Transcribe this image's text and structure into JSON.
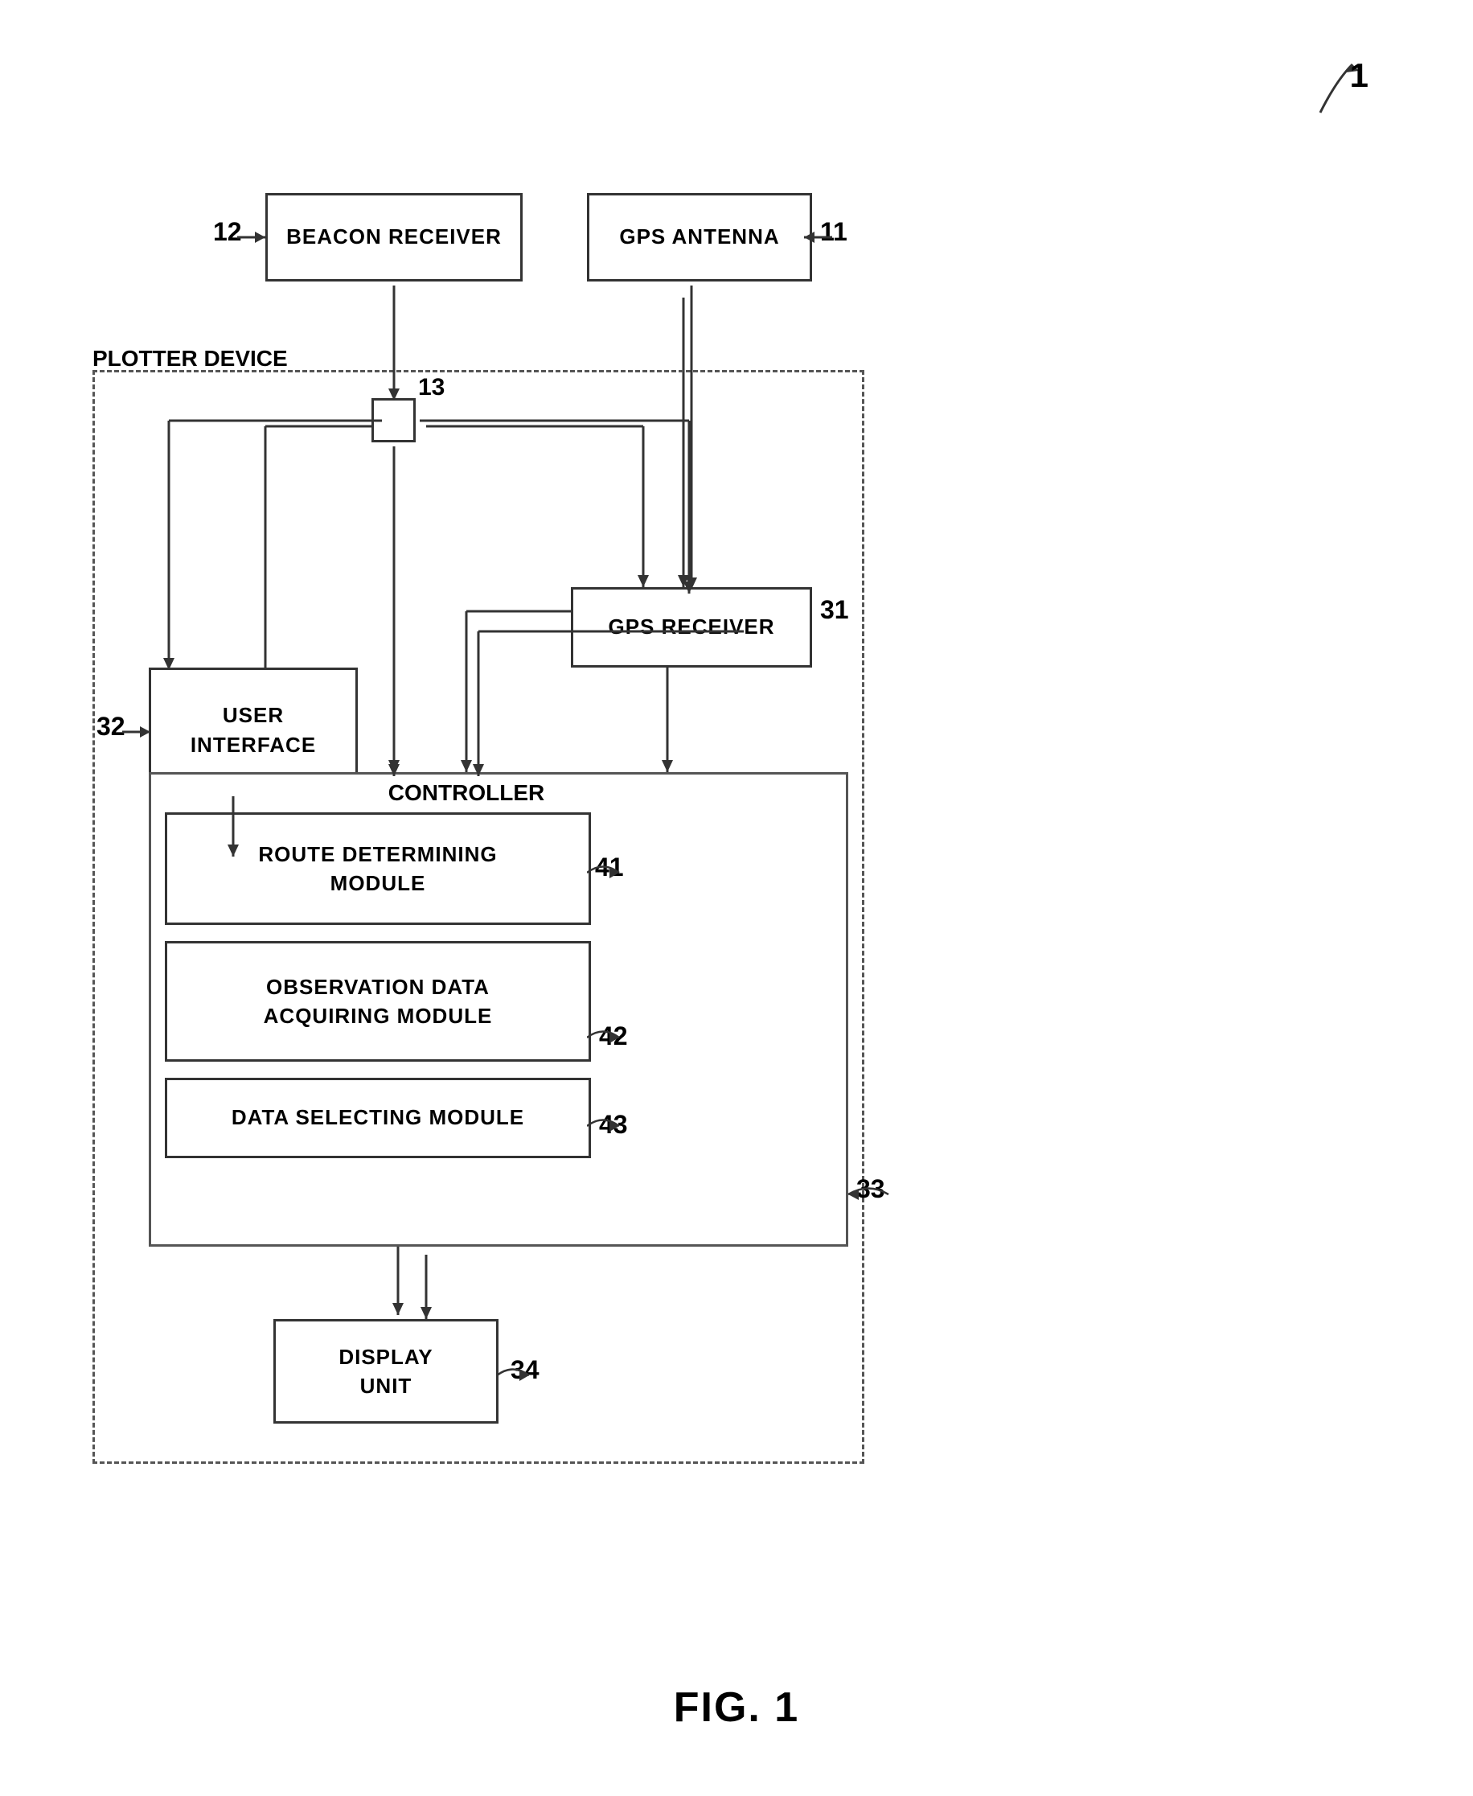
{
  "figure": {
    "label": "FIG. 1",
    "ref_main": "1"
  },
  "components": {
    "beacon_receiver": {
      "label": "BEACON RECEIVER",
      "ref": "12"
    },
    "gps_antenna": {
      "label": "GPS ANTENNA",
      "ref": "11"
    },
    "plotter_device": {
      "label": "PLOTTER DEVICE"
    },
    "user_interface": {
      "label": "USER\nINTERFACE",
      "ref": "32"
    },
    "gps_receiver": {
      "label": "GPS RECEIVER",
      "ref": "31"
    },
    "controller": {
      "label": "CONTROLLER",
      "ref": "33"
    },
    "route_determining": {
      "label": "ROUTE DETERMINING\nMODULE",
      "ref": "41"
    },
    "observation_data": {
      "label": "OBSERVATION DATA\nACQUIRING MODULE",
      "ref": "42"
    },
    "data_selecting": {
      "label": "DATA SELECTING MODULE",
      "ref": "43"
    },
    "display_unit": {
      "label": "DISPLAY\nUNIT",
      "ref": "34"
    },
    "junction_box": {
      "ref": "13"
    }
  }
}
